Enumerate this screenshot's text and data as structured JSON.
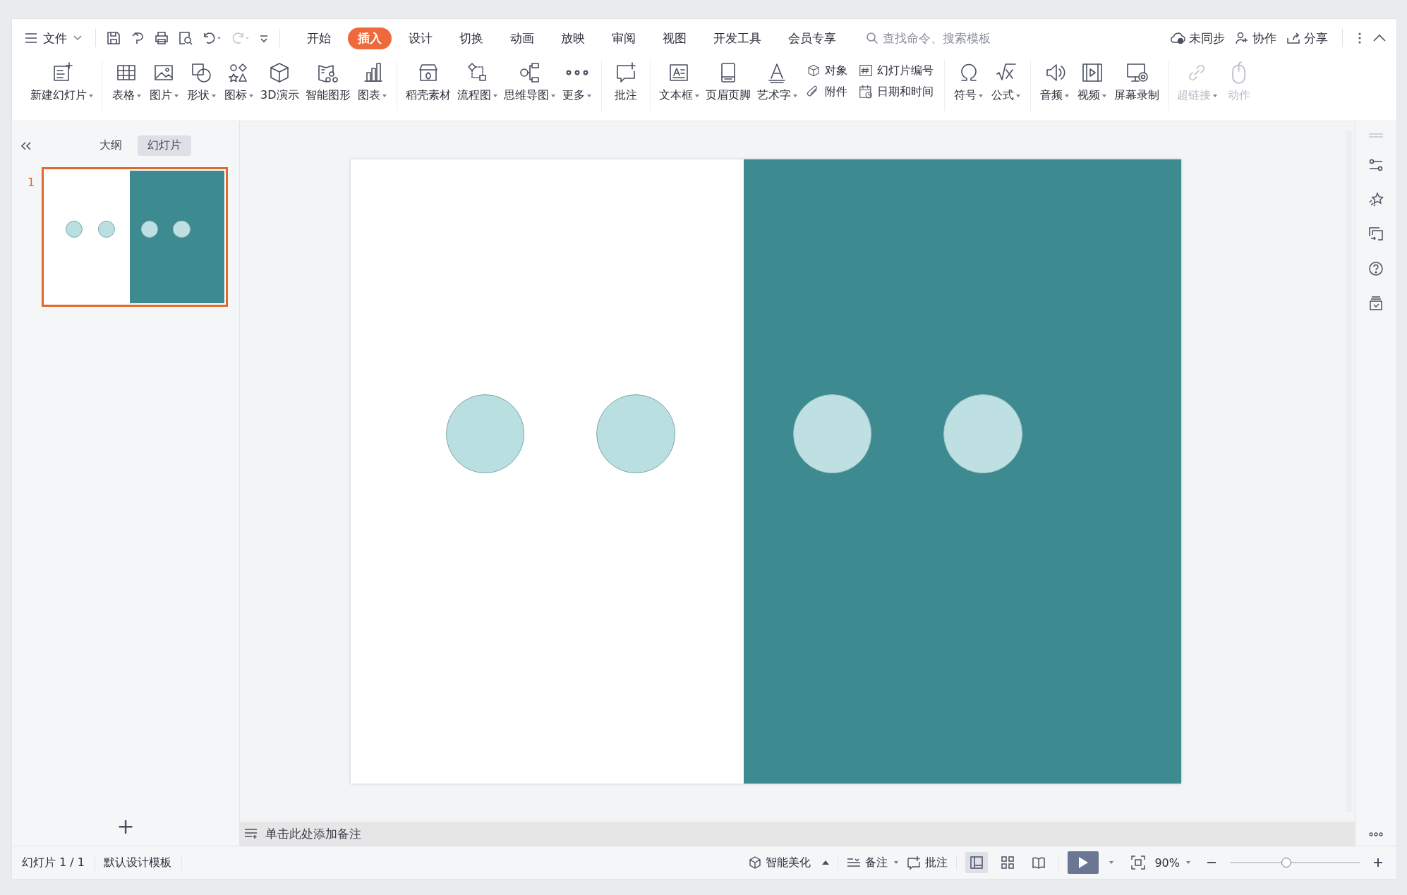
{
  "menu": {
    "file_label": "文件",
    "tabs": [
      {
        "label": "开始",
        "selected": false
      },
      {
        "label": "插入",
        "selected": true
      },
      {
        "label": "设计",
        "selected": false
      },
      {
        "label": "切换",
        "selected": false
      },
      {
        "label": "动画",
        "selected": false
      },
      {
        "label": "放映",
        "selected": false
      },
      {
        "label": "审阅",
        "selected": false
      },
      {
        "label": "视图",
        "selected": false
      },
      {
        "label": "开发工具",
        "selected": false
      },
      {
        "label": "会员专享",
        "selected": false
      }
    ],
    "search": {
      "placeholder": "查找命令、搜索模板"
    },
    "actions": [
      "未同步",
      "协作",
      "分享"
    ]
  },
  "ribbon": [
    {
      "items": [
        {
          "kind": "large",
          "label": "新建幻灯片",
          "dropdown": true,
          "disabled": false
        }
      ]
    },
    {
      "items": [
        {
          "kind": "large",
          "label": "表格",
          "dropdown": true,
          "disabled": false
        },
        {
          "kind": "large",
          "label": "图片",
          "dropdown": true,
          "disabled": false
        },
        {
          "kind": "large",
          "label": "形状",
          "dropdown": true,
          "disabled": false
        },
        {
          "kind": "large",
          "label": "图标",
          "dropdown": true,
          "disabled": false
        },
        {
          "kind": "large",
          "label": "3D演示",
          "dropdown": false,
          "disabled": false
        },
        {
          "kind": "large",
          "label": "智能图形",
          "dropdown": false,
          "disabled": false
        },
        {
          "kind": "large",
          "label": "图表",
          "dropdown": true,
          "disabled": false
        }
      ]
    },
    {
      "items": [
        {
          "kind": "large",
          "label": "稻壳素材",
          "dropdown": false,
          "disabled": false
        },
        {
          "kind": "large",
          "label": "流程图",
          "dropdown": true,
          "disabled": false
        },
        {
          "kind": "large",
          "label": "思维导图",
          "dropdown": true,
          "disabled": false
        },
        {
          "kind": "large",
          "label": "更多",
          "dropdown": true,
          "disabled": false
        }
      ]
    },
    {
      "items": [
        {
          "kind": "large",
          "label": "批注",
          "dropdown": false,
          "disabled": false
        }
      ]
    },
    {
      "items": [
        {
          "kind": "large",
          "label": "文本框",
          "dropdown": true,
          "disabled": false
        },
        {
          "kind": "large",
          "label": "页眉页脚",
          "dropdown": false,
          "disabled": false
        },
        {
          "kind": "large",
          "label": "艺术字",
          "dropdown": true,
          "disabled": false
        },
        {
          "kind": "stack",
          "items": [
            {
              "label": "对象",
              "disabled": false
            },
            {
              "label": "附件",
              "disabled": false
            }
          ]
        },
        {
          "kind": "stack",
          "items": [
            {
              "label": "幻灯片编号",
              "disabled": false
            },
            {
              "label": "日期和时间",
              "disabled": false
            }
          ]
        }
      ]
    },
    {
      "items": [
        {
          "kind": "large",
          "label": "符号",
          "dropdown": true,
          "disabled": false
        },
        {
          "kind": "large",
          "label": "公式",
          "dropdown": true,
          "disabled": false
        }
      ]
    },
    {
      "items": [
        {
          "kind": "large",
          "label": "音频",
          "dropdown": true,
          "disabled": false
        },
        {
          "kind": "large",
          "label": "视频",
          "dropdown": true,
          "disabled": false
        },
        {
          "kind": "large",
          "label": "屏幕录制",
          "dropdown": false,
          "disabled": false
        }
      ]
    },
    {
      "items": [
        {
          "kind": "large",
          "label": "超链接",
          "dropdown": true,
          "disabled": true
        },
        {
          "kind": "large",
          "label": "动作",
          "dropdown": false,
          "disabled": true
        }
      ]
    }
  ],
  "panel": {
    "tabs": [
      {
        "label": "大纲",
        "selected": false
      },
      {
        "label": "幻灯片",
        "selected": true
      }
    ],
    "slides": [
      {
        "number": "1",
        "selected": true
      }
    ],
    "add_label": "+"
  },
  "notes": {
    "placeholder": "单击此处添加备注"
  },
  "status_bar": {
    "slide_count": "幻灯片 1 / 1",
    "template": "默认设计模板",
    "beautify": "智能美化",
    "notes": "备注",
    "comments": "批注",
    "views": [
      {
        "selected": true
      },
      {
        "selected": false
      },
      {
        "selected": false
      }
    ],
    "zoom": "90%",
    "zoom_slider": {
      "level": 0.435
    }
  }
}
